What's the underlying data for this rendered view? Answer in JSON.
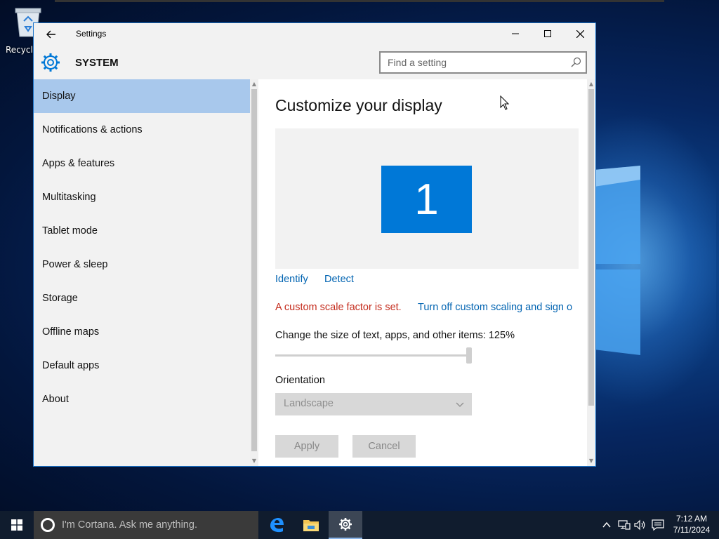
{
  "desktop": {
    "recycle_bin_label": "Recycle"
  },
  "window": {
    "title": "Settings",
    "section": "SYSTEM",
    "search": {
      "placeholder": "Find a setting"
    }
  },
  "sidebar": {
    "items": [
      {
        "label": "Display",
        "active": true
      },
      {
        "label": "Notifications & actions",
        "active": false
      },
      {
        "label": "Apps & features",
        "active": false
      },
      {
        "label": "Multitasking",
        "active": false
      },
      {
        "label": "Tablet mode",
        "active": false
      },
      {
        "label": "Power & sleep",
        "active": false
      },
      {
        "label": "Storage",
        "active": false
      },
      {
        "label": "Offline maps",
        "active": false
      },
      {
        "label": "Default apps",
        "active": false
      },
      {
        "label": "About",
        "active": false
      }
    ]
  },
  "content": {
    "title": "Customize your display",
    "monitor_number": "1",
    "identify_label": "Identify",
    "detect_label": "Detect",
    "scale_warning": "A custom scale factor is set.",
    "turn_off_link": "Turn off custom scaling and sign o",
    "size_label": "Change the size of text, apps, and other items: 125%",
    "size_slider_value_fraction": 1.0,
    "orientation_label": "Orientation",
    "orientation_value": "Landscape",
    "apply_label": "Apply",
    "cancel_label": "Cancel"
  },
  "taskbar": {
    "cortana_placeholder": "I'm Cortana. Ask me anything.",
    "apps": [
      "edge-icon",
      "file-explorer-icon",
      "settings-icon"
    ],
    "clock_time": "7:12 AM",
    "clock_date": "7/11/2024"
  },
  "colors": {
    "accent": "#0078d7",
    "link": "#0063b1",
    "warning": "#c42b1c",
    "nav_active": "#a8c8ec"
  }
}
